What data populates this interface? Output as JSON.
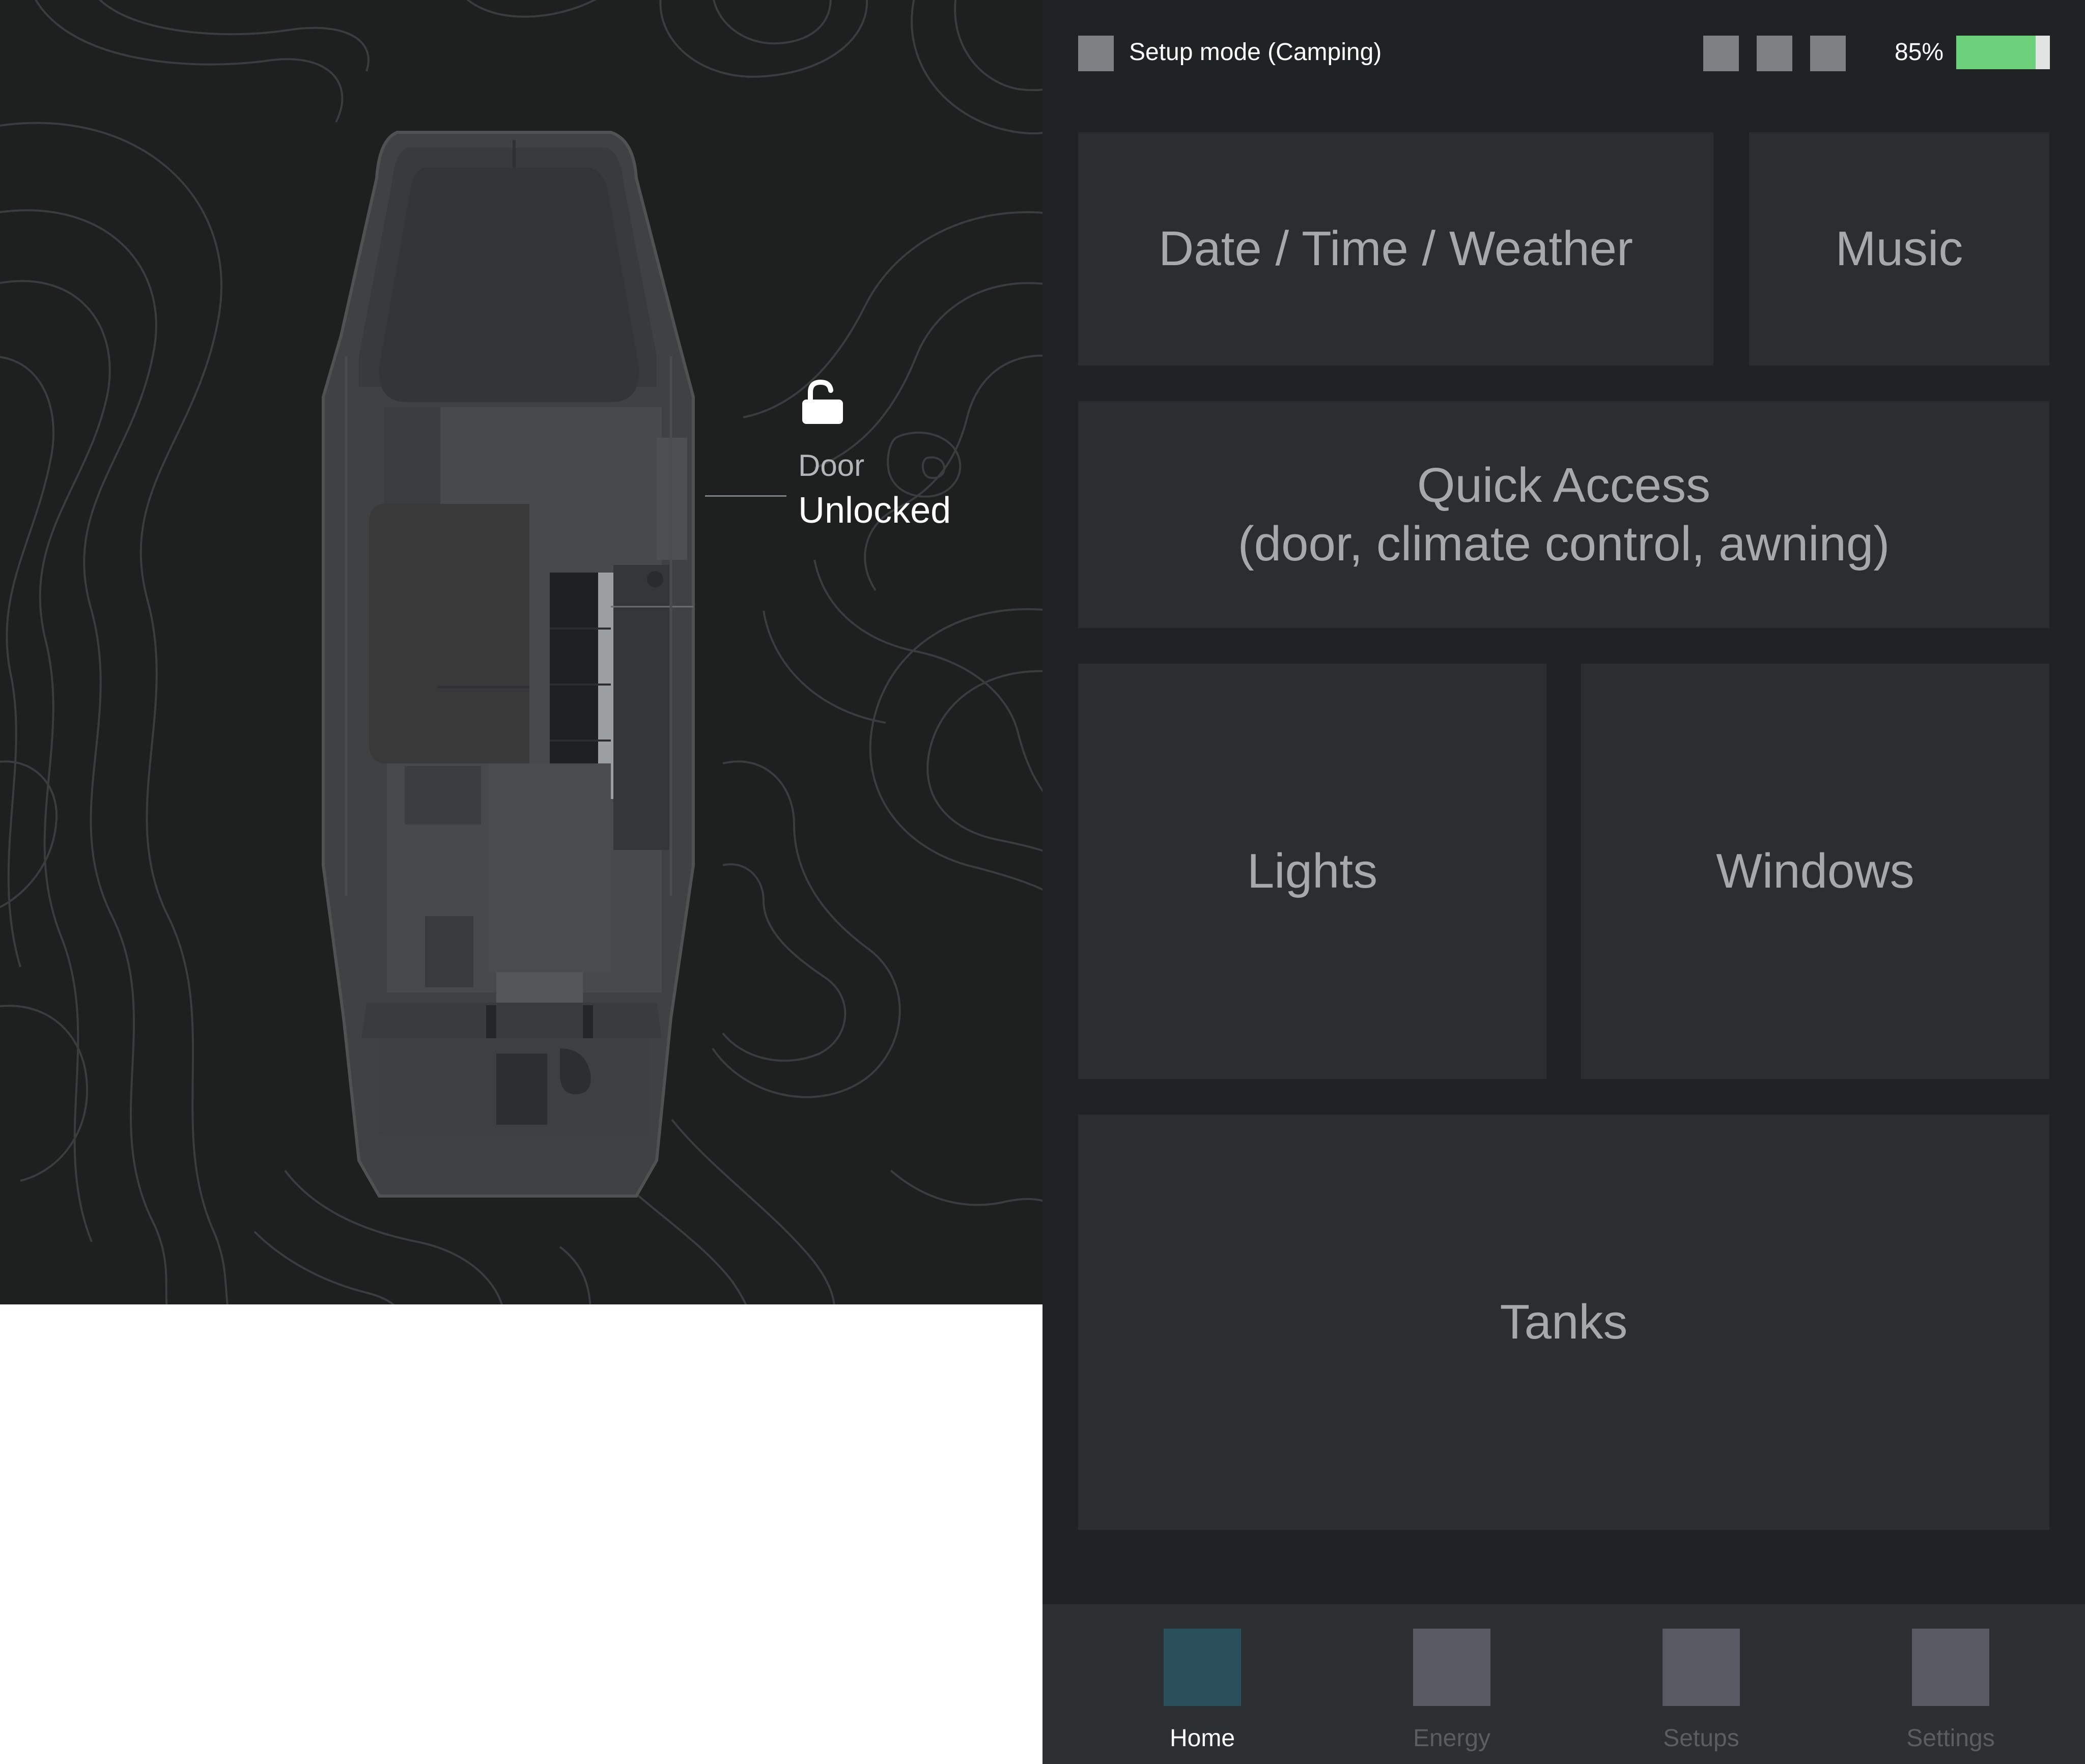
{
  "vehicle": {
    "door": {
      "label": "Door",
      "status": "Unlocked",
      "icon": "unlocked-padlock-icon"
    }
  },
  "status_bar": {
    "setup_mode": "Setup mode (Camping)",
    "battery": {
      "percent_text": "85%",
      "level": 0.85,
      "fill_color": "#6dd17b"
    }
  },
  "tiles": {
    "date_time_weather": "Date / Time / Weather",
    "music": "Music",
    "quick_access_line1": "Quick Access",
    "quick_access_line2": "(door, climate control, awning)",
    "lights": "Lights",
    "windows": "Windows",
    "tanks": "Tanks"
  },
  "nav": [
    {
      "label": "Home",
      "active": true,
      "color": "#2a505c"
    },
    {
      "label": "Energy",
      "active": false,
      "color": "#585a63"
    },
    {
      "label": "Setups",
      "active": false,
      "color": "#585a63"
    },
    {
      "label": "Settings",
      "active": false,
      "color": "#585a63"
    }
  ],
  "colors": {
    "panel_background": "#1e2020",
    "dashboard_background": "#202324",
    "tile_background": "#2a2e31",
    "nav_background": "#2c3032"
  }
}
